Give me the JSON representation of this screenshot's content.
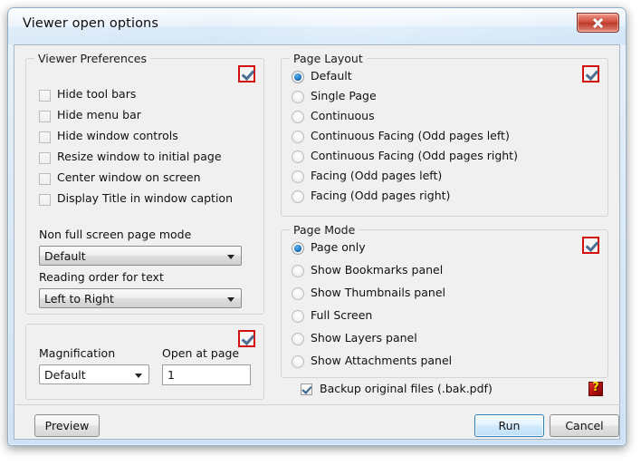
{
  "window": {
    "title": "Viewer open options",
    "close_label": "x",
    "close_icon": "close-icon"
  },
  "viewer_preferences": {
    "title": "Viewer Preferences",
    "enabled_marker": "checked",
    "checkboxes": [
      {
        "label": "Hide tool bars",
        "checked": false
      },
      {
        "label": "Hide menu bar",
        "checked": false
      },
      {
        "label": "Hide window controls",
        "checked": false
      },
      {
        "label": "Resize window to initial page",
        "checked": false
      },
      {
        "label": "Center window on screen",
        "checked": false
      },
      {
        "label": "Display Title in window caption",
        "checked": false
      }
    ],
    "non_full_screen": {
      "label": "Non full screen page mode",
      "value": "Default"
    },
    "reading_order": {
      "label": "Reading order for text",
      "value": "Left to Right"
    }
  },
  "magnification_panel": {
    "magnification": {
      "label": "Magnification",
      "value": "Default"
    },
    "open_at_page": {
      "label": "Open at page",
      "value": "1",
      "placeholder": "1"
    },
    "enabled_marker": "checked"
  },
  "page_layout": {
    "title": "Page Layout",
    "enabled_marker": "checked",
    "selected_index": 0,
    "options": [
      "Default",
      "Single Page",
      "Continuous",
      "Continuous Facing (Odd pages left)",
      "Continuous Facing (Odd pages right)",
      "Facing (Odd pages left)",
      "Facing (Odd pages right)"
    ]
  },
  "page_mode": {
    "title": "Page Mode",
    "enabled_marker": "checked",
    "selected_index": 0,
    "options": [
      "Page only",
      "Show Bookmarks panel",
      "Show Thumbnails panel",
      "Full Screen",
      "Show Layers panel",
      "Show Attachments panel"
    ]
  },
  "backup": {
    "label": "Backup original files (.bak.pdf)",
    "checked": true,
    "help_glyph": "?"
  },
  "buttons": {
    "preview": "Preview",
    "run": "Run",
    "cancel": "Cancel"
  },
  "colors": {
    "accent_red": "#d40f0f",
    "radio_blue": "#1b76c4",
    "default_button_border": "#2e7fb8"
  }
}
